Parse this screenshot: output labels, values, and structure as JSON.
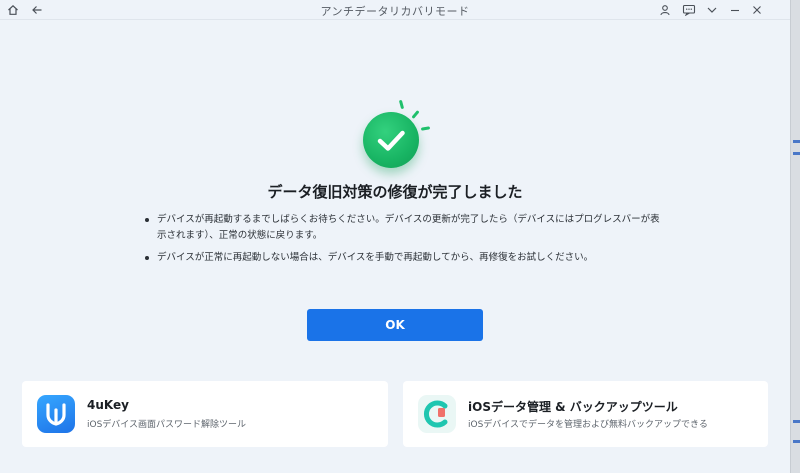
{
  "window": {
    "title": "アンチデータリカバリモード"
  },
  "main": {
    "heading": "データ復旧対策の修復が完了しました",
    "bullets": [
      "デバイスが再起動するまでしばらくお待ちください。デバイスの更新が完了したら（デバイスにはプログレスバーが表示されます）、正常の状態に戻ります。",
      "デバイスが正常に再起動しない場合は、デバイスを手動で再起動してから、再修復をお試しください。"
    ],
    "ok_label": "OK"
  },
  "cards": [
    {
      "name": "4uKey",
      "desc": "iOSデバイス画面パスワード解除ツール"
    },
    {
      "name": "iOSデータ管理 & バックアップツール",
      "desc": "iOSデバイスでデータを管理および無料バックアップできる"
    }
  ],
  "colors": {
    "background": "#eef3f9",
    "accent": "#1a73e8",
    "success": "#18b463"
  },
  "icons": {
    "home": "home-icon",
    "back": "back-arrow-icon",
    "user": "user-icon",
    "feedback": "feedback-icon",
    "menu": "chevron-down-icon",
    "minimize": "minimize-icon",
    "close": "close-icon",
    "success": "check-circle-icon"
  }
}
